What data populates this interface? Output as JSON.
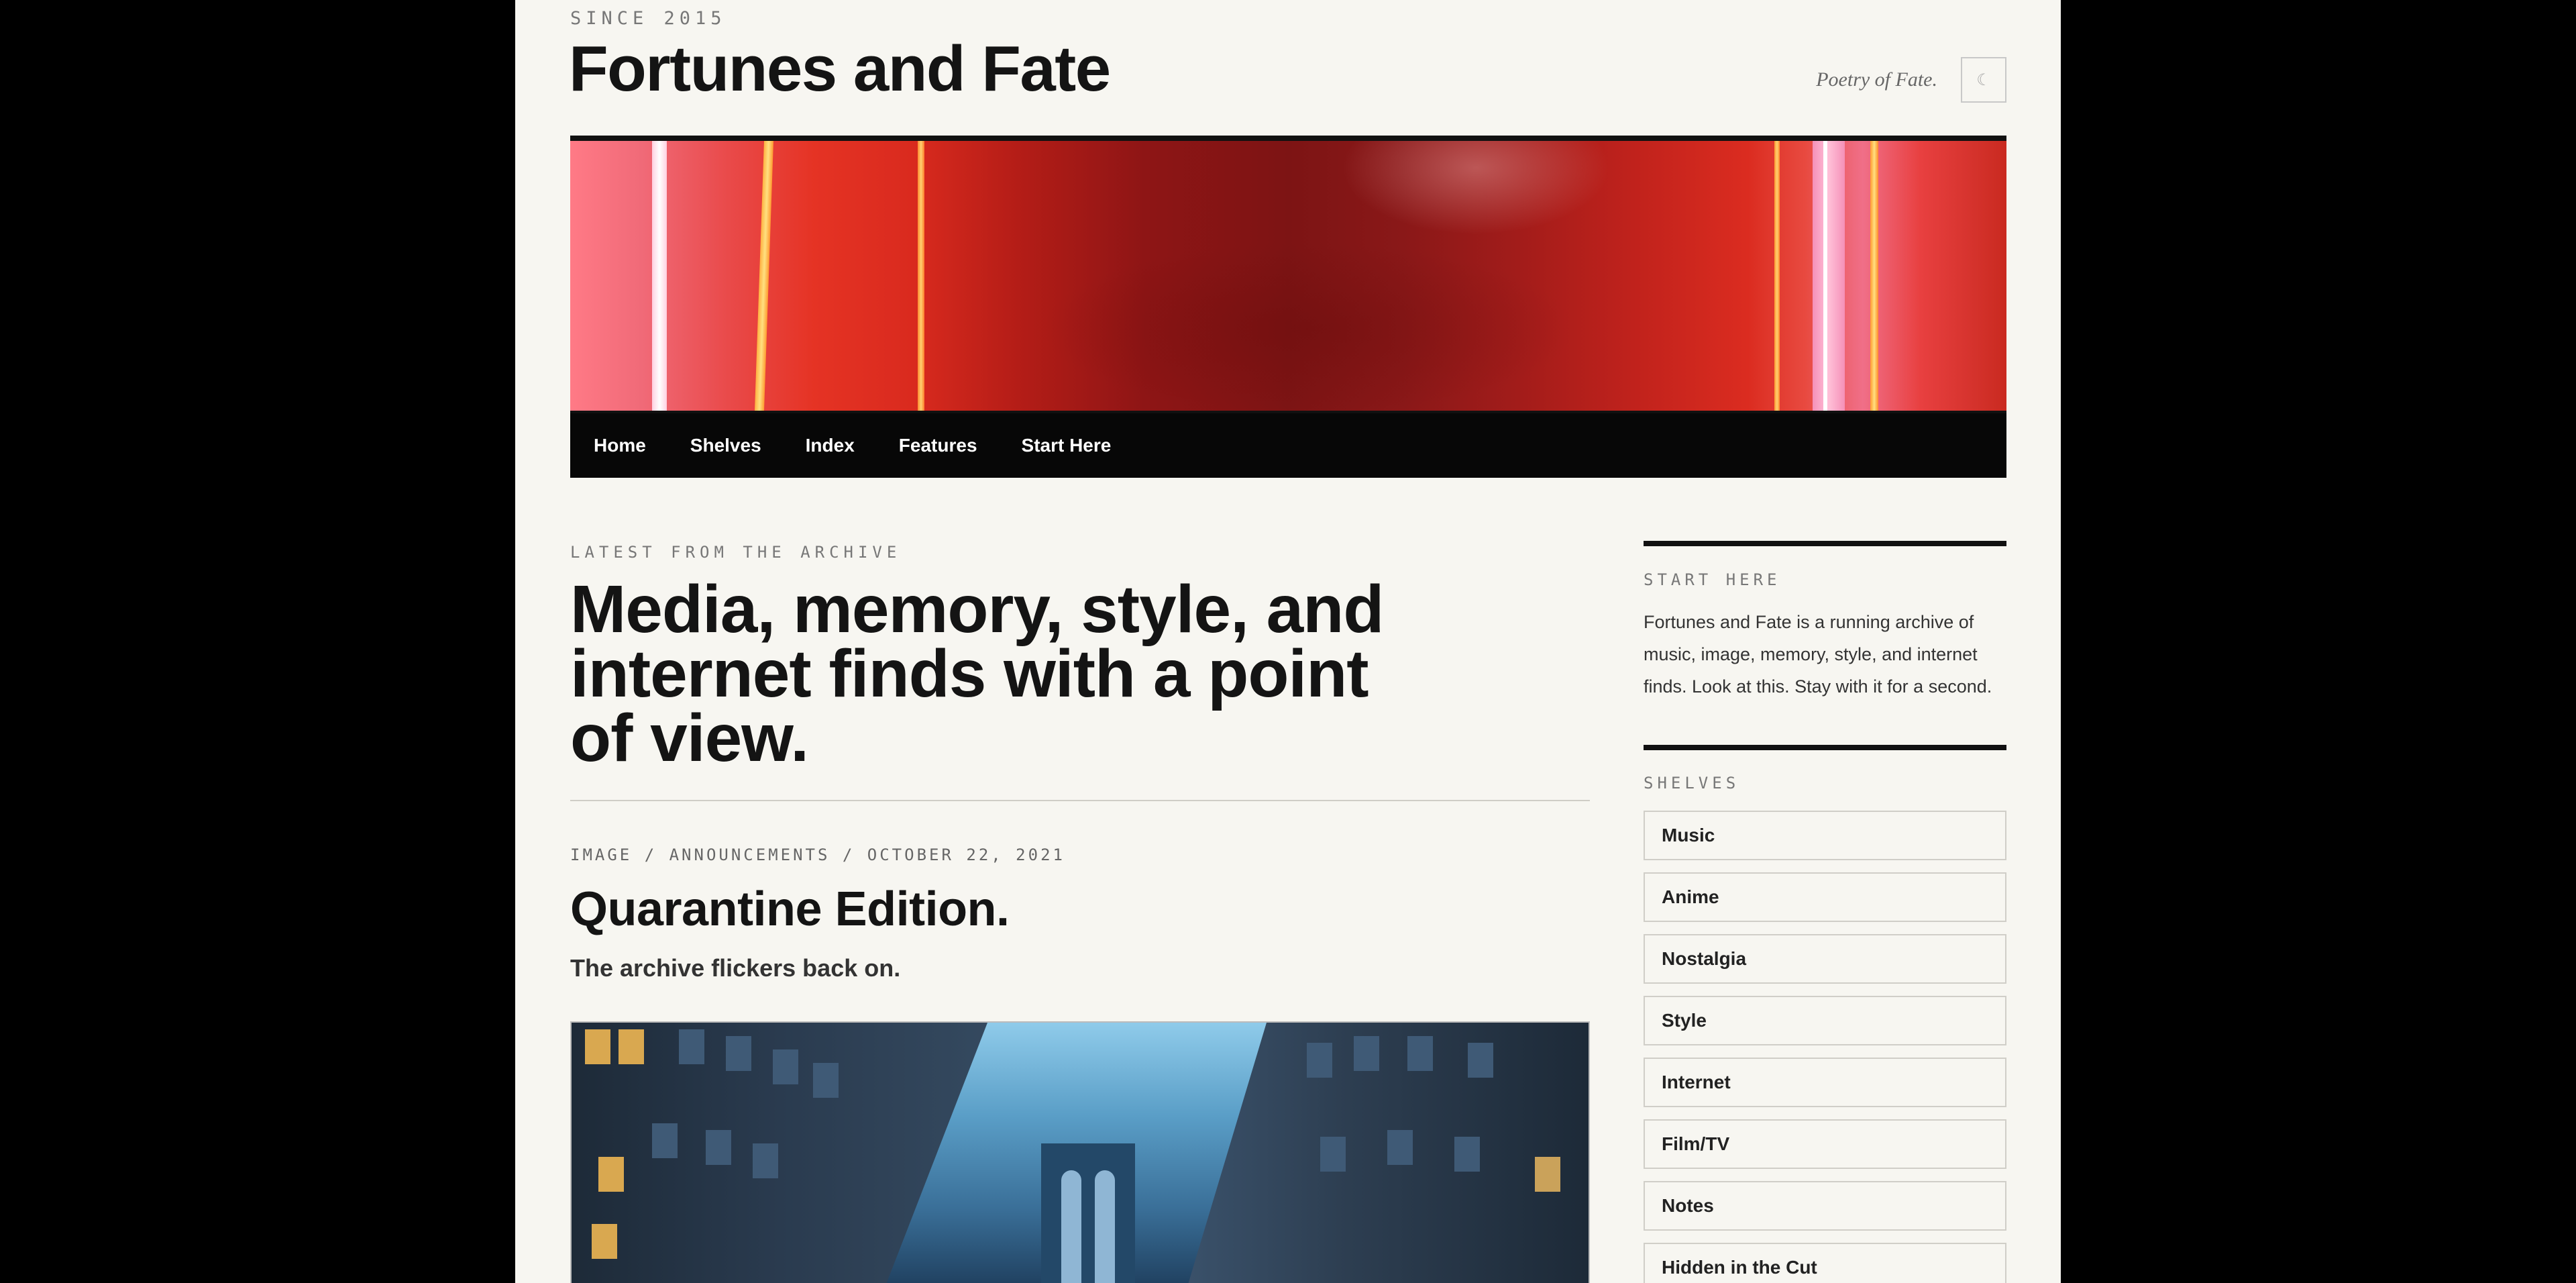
{
  "header": {
    "since": "SINCE 2015",
    "title": "Fortunes and Fate",
    "tagline": "Poetry of Fate.",
    "theme_toggle_icon": "moon-icon",
    "theme_toggle_glyph": "☾"
  },
  "nav": {
    "items": [
      "Home",
      "Shelves",
      "Index",
      "Features",
      "Start Here"
    ]
  },
  "main": {
    "eyebrow": "LATEST FROM THE ARCHIVE",
    "hero": "Media, memory, style, and internet finds with a point of view.",
    "post": {
      "meta": "IMAGE / ANNOUNCEMENTS / OCTOBER 22, 2021",
      "title": "Quarantine Edition.",
      "subtitle": "The archive flickers back on."
    }
  },
  "sidebar": {
    "start_here": {
      "heading": "START HERE",
      "text": "Fortunes and Fate is a running archive of music, image, memory, style, and internet finds. Look at this. Stay with it for a second."
    },
    "shelves": {
      "heading": "SHELVES",
      "items": [
        "Music",
        "Anime",
        "Nostalgia",
        "Style",
        "Internet",
        "Film/TV",
        "Notes",
        "Hidden in the Cut"
      ]
    }
  },
  "colors": {
    "page_bg": "#f7f6f1",
    "outer_bg": "#000000",
    "nav_bg": "#070707",
    "text": "#141414",
    "muted": "#777777"
  }
}
